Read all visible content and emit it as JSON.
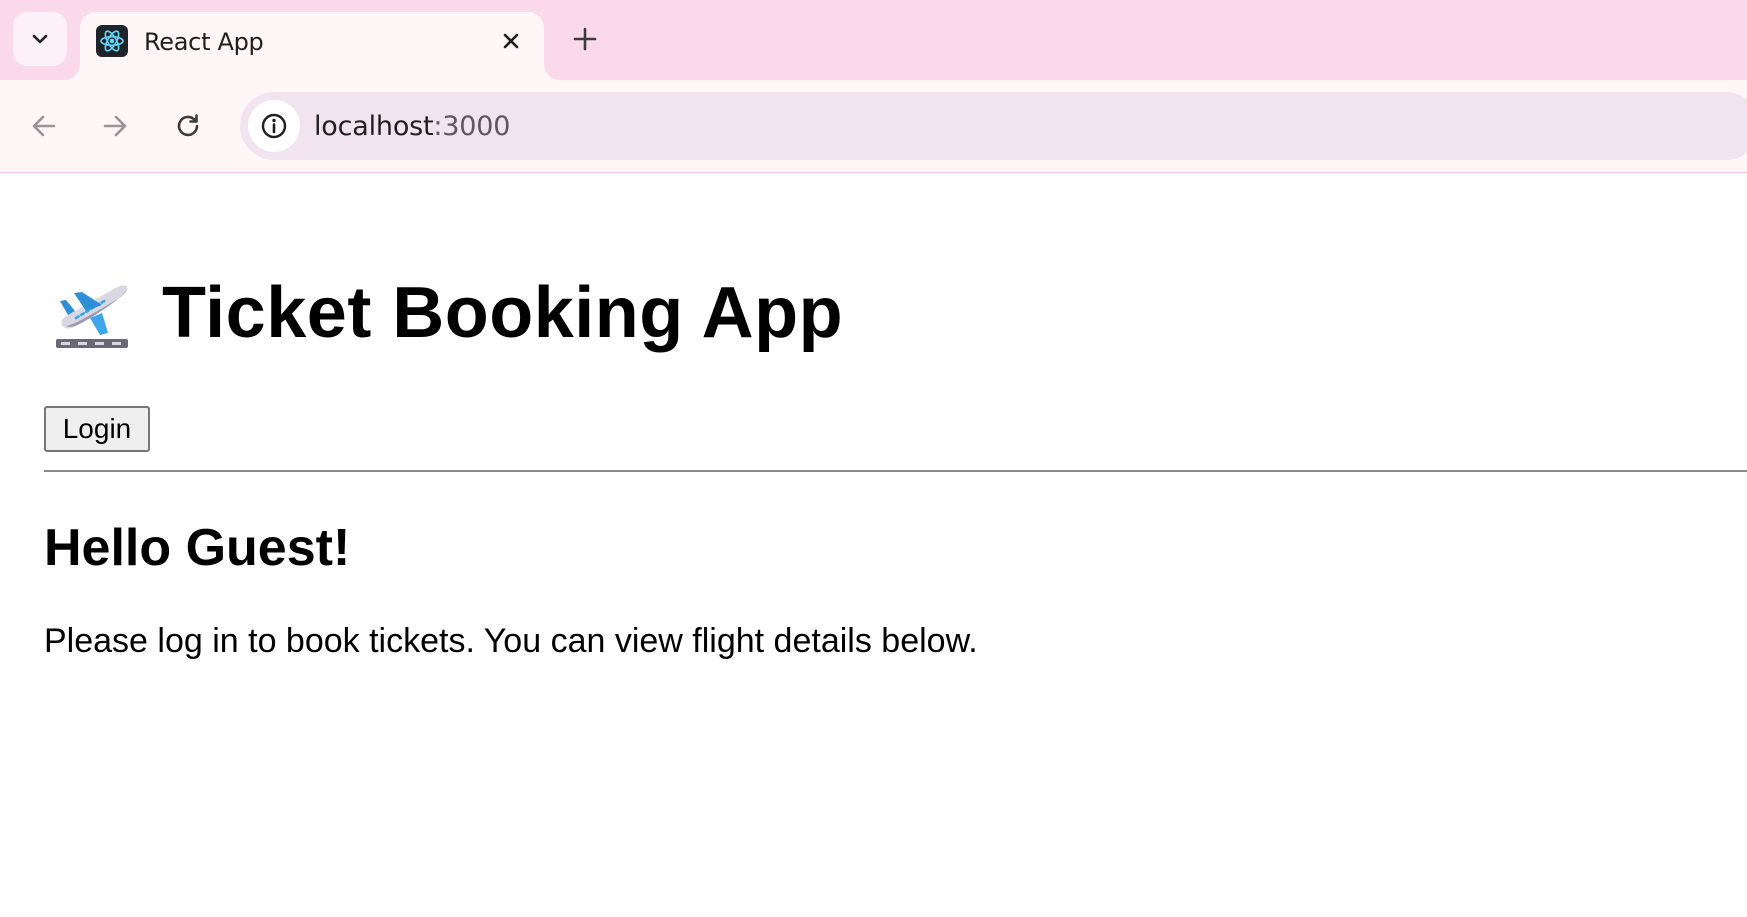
{
  "browser": {
    "tab_title": "React App",
    "url_host": "localhost",
    "url_port": ":3000",
    "tab_bg": "#fadaea",
    "toolbar_bg": "#fff6f8"
  },
  "icons": {
    "tab_search": "chevron-down-icon",
    "favicon": "react-atom-icon",
    "close": "close-icon",
    "new_tab": "plus-icon",
    "back": "arrow-left-icon",
    "forward": "arrow-right-icon",
    "reload": "reload-icon",
    "site_info": "info-circle-icon",
    "app_logo": "airplane-departure-icon"
  },
  "app": {
    "title": "Ticket Booking App",
    "login_label": "Login",
    "greeting": "Hello Guest!",
    "message": "Please log in to book tickets. You can view flight details below."
  }
}
